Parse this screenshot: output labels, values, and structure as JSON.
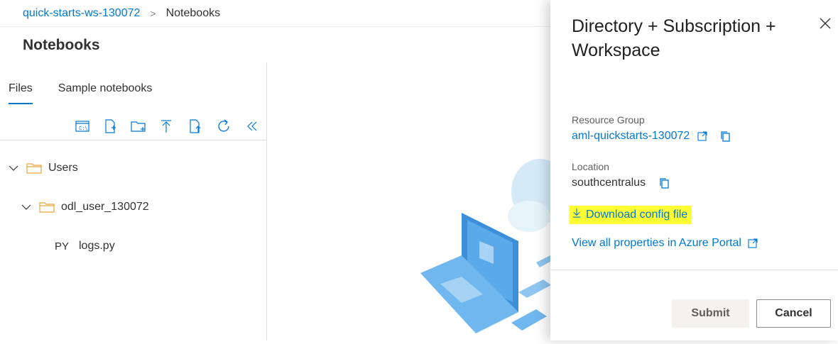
{
  "breadcrumb": {
    "workspace": "quick-starts-ws-130072",
    "separator": ">",
    "current": "Notebooks"
  },
  "page_title": "Notebooks",
  "file_panel": {
    "tabs": [
      {
        "label": "Files",
        "active": true
      },
      {
        "label": "Sample notebooks",
        "active": false
      }
    ],
    "toolbar_icons": [
      "terminal-icon",
      "new-file-icon",
      "new-folder-icon",
      "upload-icon",
      "upload-folder-icon",
      "refresh-icon",
      "collapse-icon"
    ],
    "tree": [
      {
        "label": "Users",
        "type": "folder",
        "expanded": true
      },
      {
        "label": "odl_user_130072",
        "type": "folder",
        "expanded": true
      },
      {
        "label": "logs.py",
        "type": "file",
        "badge": "PY"
      }
    ]
  },
  "side_panel": {
    "title": "Directory + Subscription + Workspace",
    "resource_group_label": "Resource Group",
    "resource_group_value": "aml-quickstarts-130072",
    "location_label": "Location",
    "location_value": "southcentralus",
    "download_label": "Download config file",
    "view_all_label": "View all properties in Azure Portal",
    "submit_label": "Submit",
    "cancel_label": "Cancel"
  },
  "colors": {
    "accent": "#0078d4",
    "highlight": "#ffff33",
    "folder": "#e8a33d"
  }
}
